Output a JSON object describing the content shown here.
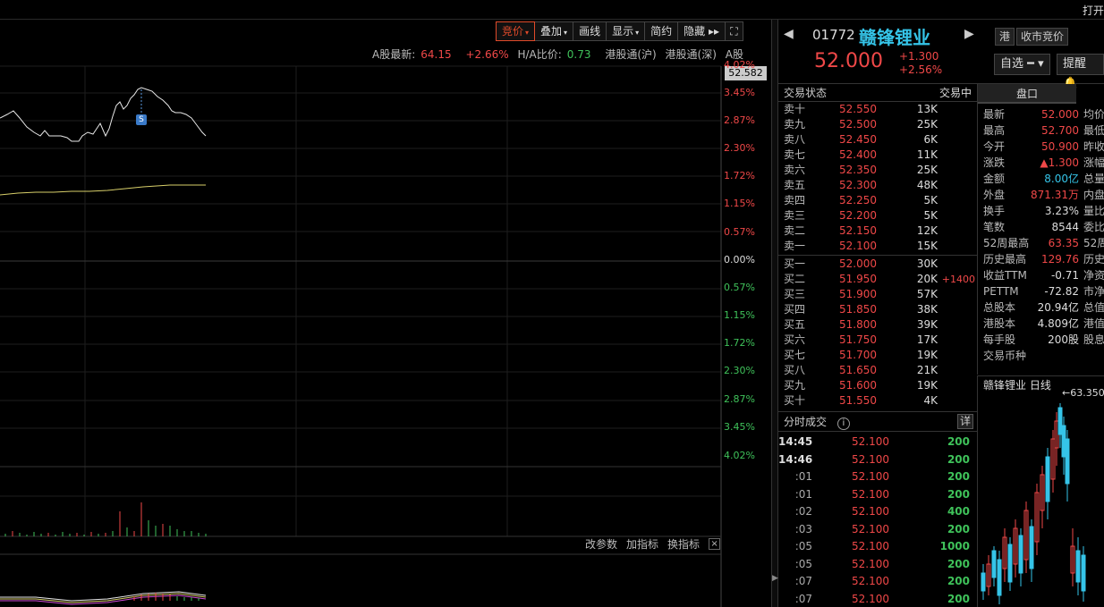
{
  "topbar": {
    "open_label": "打开"
  },
  "toolbar": {
    "items": [
      {
        "label": "竞价",
        "dropdown": true,
        "active": true
      },
      {
        "label": "叠加",
        "dropdown": true
      },
      {
        "label": "画线",
        "dropdown": false
      },
      {
        "label": "显示",
        "dropdown": true
      },
      {
        "label": "简约",
        "dropdown": false
      },
      {
        "label": "隐藏 ▸▸",
        "dropdown": false
      }
    ],
    "expand_icon": "expand-icon"
  },
  "infoline": {
    "a_label": "A股最新:",
    "a_price": "64.15",
    "a_chg": "+2.66%",
    "ha_label": "H/A比价:",
    "ha_value": "0.73",
    "sh": "港股通(沪)",
    "sz": "港股通(深)",
    "a": "A股"
  },
  "chart": {
    "current_price": "52.582",
    "pct_labels": [
      {
        "text": "4.02%",
        "kind": "r"
      },
      {
        "text": "3.45%",
        "kind": "r"
      },
      {
        "text": "2.87%",
        "kind": "r"
      },
      {
        "text": "2.30%",
        "kind": "r"
      },
      {
        "text": "1.72%",
        "kind": "r"
      },
      {
        "text": "1.15%",
        "kind": "r"
      },
      {
        "text": "0.57%",
        "kind": "r"
      },
      {
        "text": "0.00%",
        "kind": "w"
      },
      {
        "text": "0.57%",
        "kind": "g"
      },
      {
        "text": "1.15%",
        "kind": "g"
      },
      {
        "text": "1.72%",
        "kind": "g"
      },
      {
        "text": "2.30%",
        "kind": "g"
      },
      {
        "text": "2.87%",
        "kind": "g"
      },
      {
        "text": "3.45%",
        "kind": "g"
      },
      {
        "text": "4.02%",
        "kind": "g"
      }
    ],
    "marker_label": "S",
    "subtoolbar": {
      "a": "改参数",
      "b": "加指标",
      "c": "换指标",
      "close": "×"
    }
  },
  "stock": {
    "code": "01772",
    "name": "赣锋锂业",
    "price": "52.000",
    "chg": "+1.300",
    "chg_pct": "+2.56%",
    "tag_hk": "港",
    "tag_auction": "收市竞价",
    "watch_btn": "自选 ━ ▾",
    "alert_btn": "提醒 🔔"
  },
  "order_book": {
    "header_left": "交易状态",
    "header_right": "交易中",
    "asks": [
      {
        "label": "卖十",
        "price": "52.550",
        "vol": "13K"
      },
      {
        "label": "卖九",
        "price": "52.500",
        "vol": "25K"
      },
      {
        "label": "卖八",
        "price": "52.450",
        "vol": "6K"
      },
      {
        "label": "卖七",
        "price": "52.400",
        "vol": "11K"
      },
      {
        "label": "卖六",
        "price": "52.350",
        "vol": "25K"
      },
      {
        "label": "卖五",
        "price": "52.300",
        "vol": "48K"
      },
      {
        "label": "卖四",
        "price": "52.250",
        "vol": "5K"
      },
      {
        "label": "卖三",
        "price": "52.200",
        "vol": "5K"
      },
      {
        "label": "卖二",
        "price": "52.150",
        "vol": "12K"
      },
      {
        "label": "卖一",
        "price": "52.100",
        "vol": "15K"
      }
    ],
    "bids": [
      {
        "label": "买一",
        "price": "52.000",
        "vol": "30K",
        "delta": ""
      },
      {
        "label": "买二",
        "price": "51.950",
        "vol": "20K",
        "delta": "+1400"
      },
      {
        "label": "买三",
        "price": "51.900",
        "vol": "57K",
        "delta": ""
      },
      {
        "label": "买四",
        "price": "51.850",
        "vol": "38K",
        "delta": ""
      },
      {
        "label": "买五",
        "price": "51.800",
        "vol": "39K",
        "delta": ""
      },
      {
        "label": "买六",
        "price": "51.750",
        "vol": "17K",
        "delta": ""
      },
      {
        "label": "买七",
        "price": "51.700",
        "vol": "19K",
        "delta": ""
      },
      {
        "label": "买八",
        "price": "51.650",
        "vol": "21K",
        "delta": ""
      },
      {
        "label": "买九",
        "price": "51.600",
        "vol": "19K",
        "delta": ""
      },
      {
        "label": "买十",
        "price": "51.550",
        "vol": "4K",
        "delta": ""
      }
    ]
  },
  "ticks": {
    "title": "分时成交",
    "info": "i",
    "detail": "详",
    "rows": [
      {
        "time": "14:45",
        "main": true,
        "price": "52.100",
        "vol": "200"
      },
      {
        "time": "14:46",
        "main": true,
        "price": "52.100",
        "vol": "200"
      },
      {
        "time": ":01",
        "main": false,
        "price": "52.100",
        "vol": "200"
      },
      {
        "time": ":01",
        "main": false,
        "price": "52.100",
        "vol": "200"
      },
      {
        "time": ":02",
        "main": false,
        "price": "52.100",
        "vol": "400"
      },
      {
        "time": ":03",
        "main": false,
        "price": "52.100",
        "vol": "200"
      },
      {
        "time": ":05",
        "main": false,
        "price": "52.100",
        "vol": "1000"
      },
      {
        "time": ":05",
        "main": false,
        "price": "52.100",
        "vol": "200"
      },
      {
        "time": ":07",
        "main": false,
        "price": "52.100",
        "vol": "200"
      },
      {
        "time": ":07",
        "main": false,
        "price": "52.100",
        "vol": "200"
      }
    ]
  },
  "pankou": {
    "tab": "盘口",
    "rows": [
      {
        "k": "最新",
        "v": "52.000",
        "c": "red",
        "k2": "均价"
      },
      {
        "k": "最高",
        "v": "52.700",
        "c": "red",
        "k2": "最低"
      },
      {
        "k": "今开",
        "v": "50.900",
        "c": "red",
        "k2": "昨收"
      },
      {
        "k": "涨跌",
        "v": "▲1.300",
        "c": "red",
        "k2": "涨幅"
      },
      {
        "k": "金额",
        "v": "8.00亿",
        "c": "cyan",
        "k2": "总量"
      },
      {
        "k": "外盘",
        "v": "871.31万",
        "c": "red",
        "k2": "内盘"
      },
      {
        "k": "换手",
        "v": "3.23%",
        "c": "",
        "k2": "量比"
      },
      {
        "k": "笔数",
        "v": "8544",
        "c": "",
        "k2": "委比"
      },
      {
        "k": "52周最高",
        "v": "63.35",
        "c": "red",
        "k2": "52周"
      },
      {
        "k": "历史最高",
        "v": "129.76",
        "c": "red",
        "k2": "历史"
      },
      {
        "k": "收益TTM",
        "v": "-0.71",
        "c": "",
        "k2": "净资"
      },
      {
        "k": "PETTM",
        "v": "-72.82",
        "c": "",
        "k2": "市净"
      },
      {
        "k": "总股本",
        "v": "20.94亿",
        "c": "",
        "k2": "总值"
      },
      {
        "k": "港股本",
        "v": "4.809亿",
        "c": "",
        "k2": "港值"
      },
      {
        "k": "每手股",
        "v": "200股",
        "c": "",
        "k2": "股息"
      },
      {
        "k": "交易币种",
        "v": "",
        "c": "",
        "k2": ""
      }
    ]
  },
  "daily": {
    "title": "赣锋锂业 日线",
    "max_label": "←63.350"
  }
}
